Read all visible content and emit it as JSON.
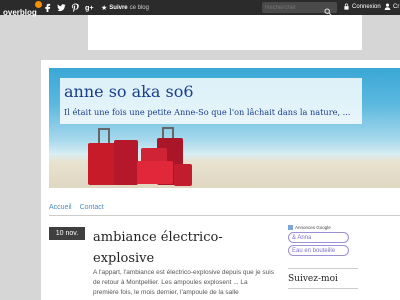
{
  "topbar": {
    "logo_text": "overblog",
    "social_icons": [
      "facebook-icon",
      "twitter-icon",
      "pinterest-icon",
      "google-plus-icon"
    ],
    "follow_bold": "Suivre",
    "follow_light": "ce blog",
    "search_placeholder": "Rechercher",
    "login_label": "Connexion",
    "create_label": "Cr"
  },
  "banner": {
    "blog_title": "anne so aka so6",
    "blog_subtitle": "Il était une fois une petite Anne-So que l'on lâchait dans la nature, ..."
  },
  "nav": {
    "items": [
      "Accueil",
      "Contact"
    ]
  },
  "post": {
    "date": "10 nov.",
    "title": "ambiance électrico-explosive",
    "body": "A l'appart, l'ambiance est électrico-explosive depuis que je suis de retour à Montpellier. Les ampoules explosent ... La première fois, le mois dernier, l'ampoule de la salle"
  },
  "sidebar": {
    "ads_label": "Annonces Google",
    "pills": [
      "& Anna",
      "Eau en bouteille"
    ],
    "suivez_title": "Suivez-moi"
  },
  "colors": {
    "topbar_bg": "#2b2b2b",
    "link": "#4b8bbf",
    "title": "#1a3f8a",
    "badge_bg": "#3f3f3f",
    "logo_accent": "#f39200"
  }
}
